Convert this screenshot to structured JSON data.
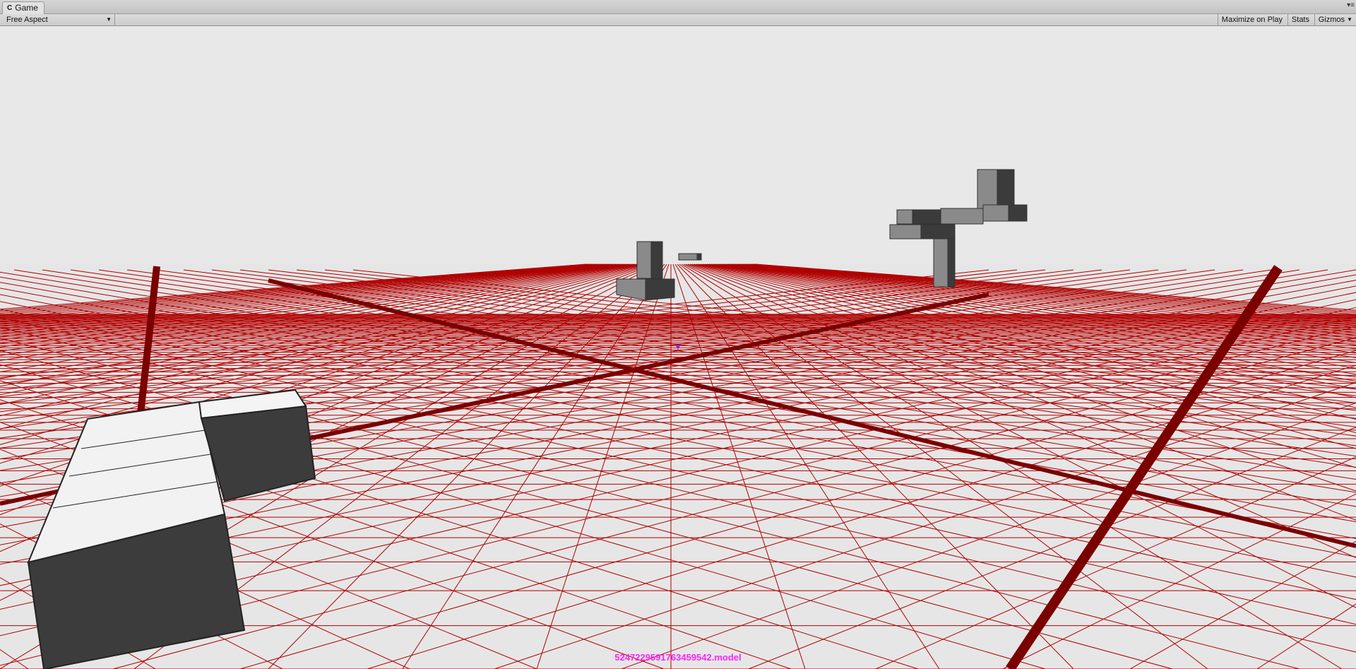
{
  "window": {
    "tab_title": "Game",
    "tab_icon": "unity-icon",
    "menu_icon": "window-menu-icon"
  },
  "toolbar": {
    "aspect_label": "Free Aspect",
    "maximize_label": "Maximize on Play",
    "stats_label": "Stats",
    "gizmos_label": "Gizmos"
  },
  "viewport": {
    "sky_color": "#e8e8e8",
    "grid_color": "#b00000",
    "axis_color": "#7a0000",
    "model_label": "5247229591763459542.model"
  }
}
